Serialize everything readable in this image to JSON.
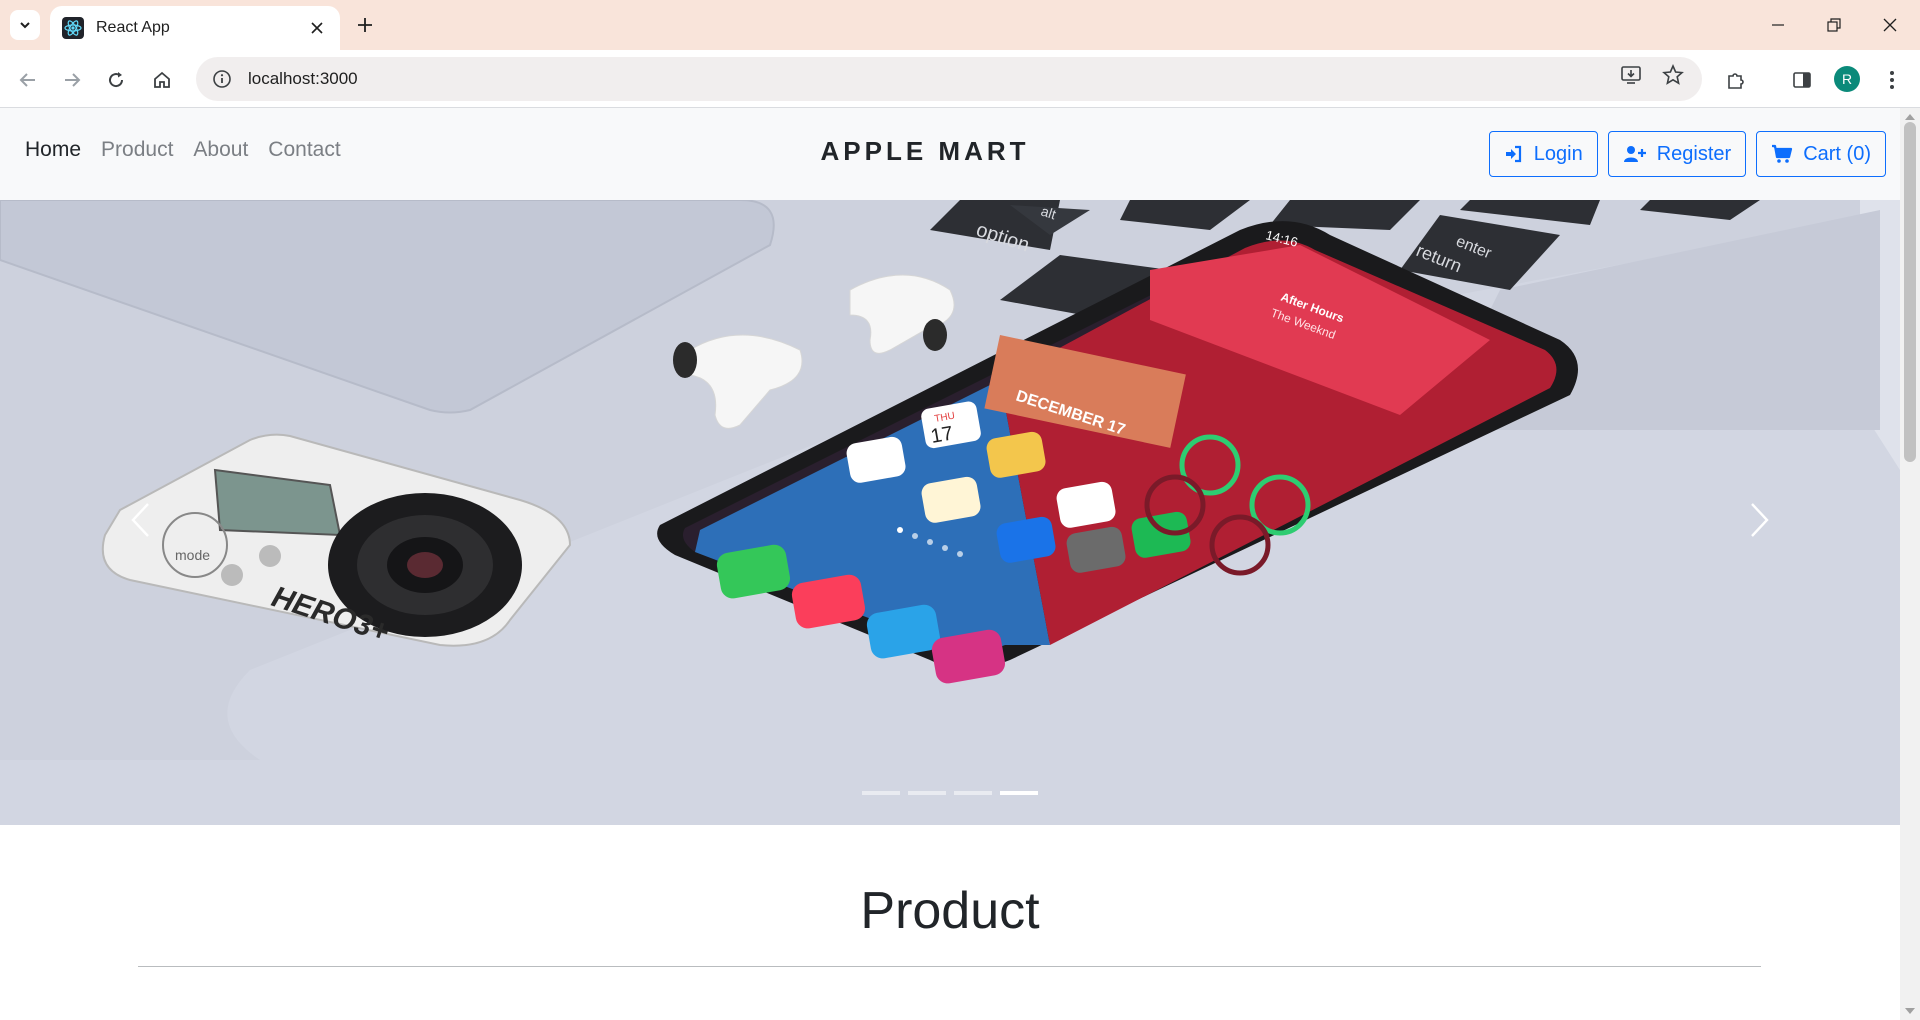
{
  "browser": {
    "tab_title": "React App",
    "url": "localhost:3000",
    "profile_initial": "R"
  },
  "nav": {
    "links": [
      {
        "label": "Home",
        "active": true
      },
      {
        "label": "Product",
        "active": false
      },
      {
        "label": "About",
        "active": false
      },
      {
        "label": "Contact",
        "active": false
      }
    ],
    "brand": "APPLE MART",
    "login_label": "Login",
    "register_label": "Register",
    "cart_label": "Cart (0)"
  },
  "carousel": {
    "slide_count": 4,
    "active_slide": 4,
    "camera_label": "HERO3+",
    "camera_mode_label": "mode",
    "phone_time": "14:16",
    "phone_date": "DECEMBER 17",
    "calendar_day": "17",
    "calendar_weekday": "THU",
    "music_title": "After Hours",
    "music_artist": "The Weeknd",
    "keys": [
      "option",
      "alt",
      "enter",
      "return"
    ]
  },
  "section": {
    "title": "Product"
  },
  "colors": {
    "accent": "#0d6efd",
    "tabbar": "#f9e4da",
    "navbar_bg": "#f8f9fa"
  }
}
